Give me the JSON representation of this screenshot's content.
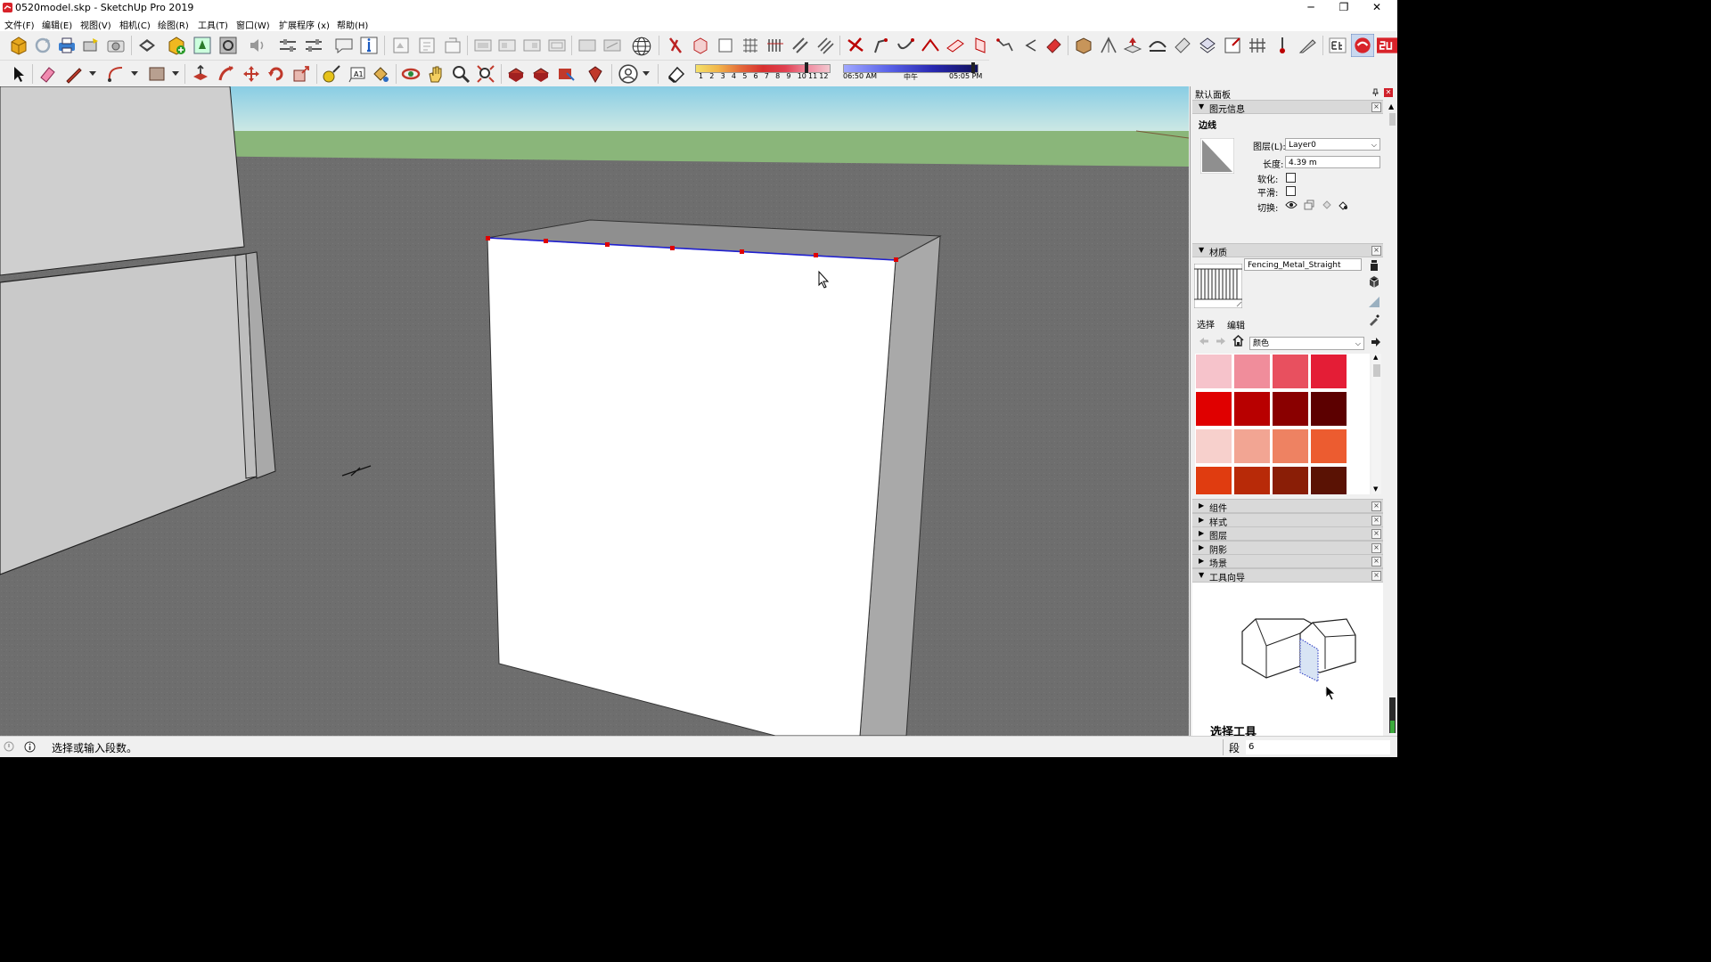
{
  "window": {
    "title": "0520model.skp - SketchUp Pro 2019",
    "minimize_glyph": "─",
    "restore_glyph": "❐",
    "close_glyph": "✕"
  },
  "menu": [
    {
      "id": "file",
      "label": "文件(F)"
    },
    {
      "id": "edit",
      "label": "编辑(E)"
    },
    {
      "id": "view",
      "label": "视图(V)"
    },
    {
      "id": "camera",
      "label": "相机(C)"
    },
    {
      "id": "draw",
      "label": "绘图(R)"
    },
    {
      "id": "tools",
      "label": "工具(T)"
    },
    {
      "id": "window",
      "label": "窗口(W)"
    },
    {
      "id": "extensions",
      "label": "扩展程序 (x)"
    },
    {
      "id": "help",
      "label": "帮助(H)"
    }
  ],
  "shadow_bar": {
    "months": [
      "1",
      "2",
      "3",
      "4",
      "5",
      "6",
      "7",
      "8",
      "9",
      "10",
      "11",
      "12"
    ],
    "time_start": "06:50 AM",
    "time_mid": "中午",
    "time_end": "05:05 PM"
  },
  "panel": {
    "title": "默认面板",
    "entity_info": {
      "header": "图元信息",
      "entity_type": "边线",
      "layer_label": "图层(L):",
      "layer_value": "Layer0",
      "length_label": "长度:",
      "length_value": "4.39 m",
      "soften_label": "软化:",
      "smooth_label": "平滑:",
      "toggle_label": "切换:"
    },
    "materials": {
      "header": "材质",
      "material_name": "Fencing_Metal_Straight",
      "tab_select": "选择",
      "tab_edit": "编辑",
      "library": "颜色",
      "swatches": [
        "#f6c3cb",
        "#f08d9b",
        "#e8505f",
        "#e41d36",
        "#e00000",
        "#b80000",
        "#8a0000",
        "#5c0000",
        "#f7d0cc",
        "#f2a593",
        "#ee8262",
        "#ec5c30",
        "#e03c10",
        "#b82a08",
        "#8a1e06",
        "#5a1204"
      ]
    },
    "collapsed_sections": [
      {
        "id": "components",
        "label": "组件"
      },
      {
        "id": "styles",
        "label": "样式"
      },
      {
        "id": "layers",
        "label": "图层"
      },
      {
        "id": "shadows",
        "label": "阴影"
      },
      {
        "id": "scenes",
        "label": "场景"
      }
    ],
    "instructor": {
      "header": "工具向导",
      "tool_title": "选择工具"
    }
  },
  "status": {
    "message": "选择或输入段数。",
    "vcb_label": "段",
    "vcb_value": "6"
  },
  "colors": {
    "sky_top": "#8fd0e3",
    "grass": "#8ab67a",
    "ground": "#6f6f6f",
    "selected_edge": "#2020d0",
    "segment_points": "#e00000"
  }
}
